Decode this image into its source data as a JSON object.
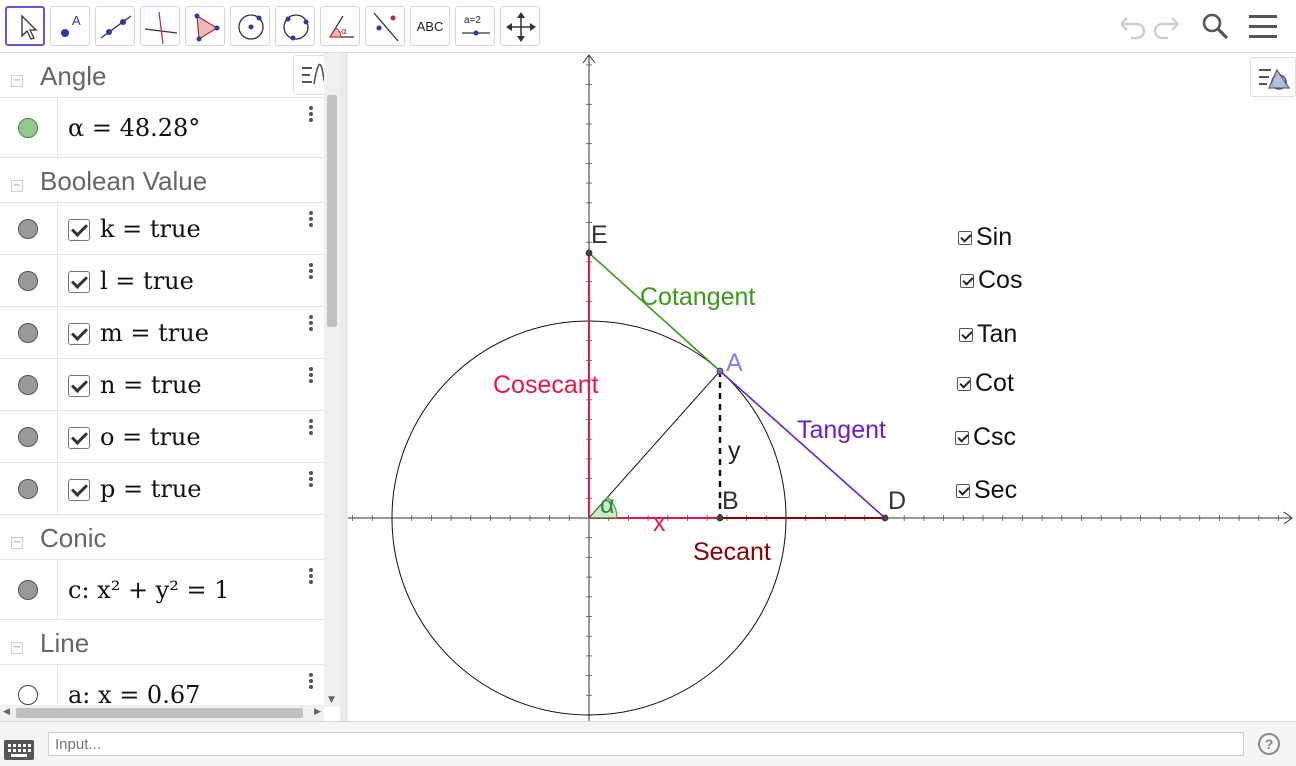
{
  "toolbar": {
    "tools": [
      {
        "name": "move-tool"
      },
      {
        "name": "point-tool",
        "label": "A"
      },
      {
        "name": "line-tool"
      },
      {
        "name": "perpendicular-line-tool"
      },
      {
        "name": "polygon-tool"
      },
      {
        "name": "circle-center-point-tool"
      },
      {
        "name": "circle-three-points-tool"
      },
      {
        "name": "angle-tool",
        "label": "α"
      },
      {
        "name": "reflect-tool"
      },
      {
        "name": "text-tool",
        "label": "ABC"
      },
      {
        "name": "slider-tool",
        "label": "a=2"
      },
      {
        "name": "move-graphics-view-tool"
      }
    ],
    "right": [
      "undo-icon",
      "redo-icon",
      "search-icon",
      "menu-icon"
    ]
  },
  "algebra": {
    "groups": [
      {
        "title": "Angle",
        "items": [
          {
            "expr": "α = 48.28°",
            "color": "#8fc98a"
          }
        ]
      },
      {
        "title": "Boolean Value",
        "items": [
          {
            "expr": "k = true",
            "checked": true
          },
          {
            "expr": "l = true",
            "checked": true
          },
          {
            "expr": "m = true",
            "checked": true
          },
          {
            "expr": "n = true",
            "checked": true
          },
          {
            "expr": "o = true",
            "checked": true
          },
          {
            "expr": "p = true",
            "checked": true
          }
        ]
      },
      {
        "title": "Conic",
        "items": [
          {
            "expr": "c: x² + y² = 1"
          }
        ]
      },
      {
        "title": "Line",
        "items": [
          {
            "expr": "a: x = 0.67"
          }
        ]
      }
    ]
  },
  "graphics": {
    "points": {
      "A": "A",
      "B": "B",
      "D": "D",
      "E": "E"
    },
    "labels": {
      "cosecant": "Cosecant",
      "cotangent": "Cotangent",
      "tangent": "Tangent",
      "secant": "Secant",
      "x": "x",
      "y": "y",
      "alpha": "α"
    },
    "checkboxes": [
      "Sin",
      "Cos",
      "Tan",
      "Cot",
      "Csc",
      "Sec"
    ],
    "colors": {
      "cosecant": "#e8174a",
      "cotangent": "#3a9a1a",
      "tangent": "#6a1ec8",
      "secant": "#8b0000",
      "x": "#e8174a",
      "point_a": "#8080ee",
      "angle": "#2f8a2f"
    }
  },
  "input": {
    "placeholder": "Input..."
  },
  "help": "?"
}
